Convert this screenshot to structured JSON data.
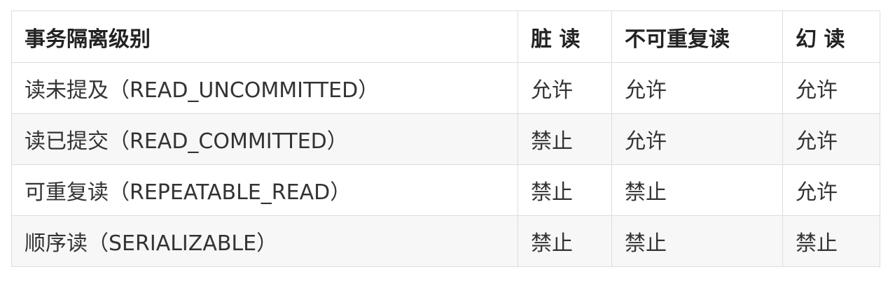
{
  "table": {
    "headers": [
      "事务隔离级别",
      "脏 读",
      "不可重复读",
      "幻 读"
    ],
    "rows": [
      [
        "读未提及（READ_UNCOMMITTED）",
        "允许",
        "允许",
        "允许"
      ],
      [
        "读已提交（READ_COMMITTED）",
        "禁止",
        "允许",
        "允许"
      ],
      [
        "可重复读（REPEATABLE_READ）",
        "禁止",
        "禁止",
        "允许"
      ],
      [
        "顺序读（SERIALIZABLE）",
        "禁止",
        "禁止",
        "禁止"
      ]
    ]
  }
}
